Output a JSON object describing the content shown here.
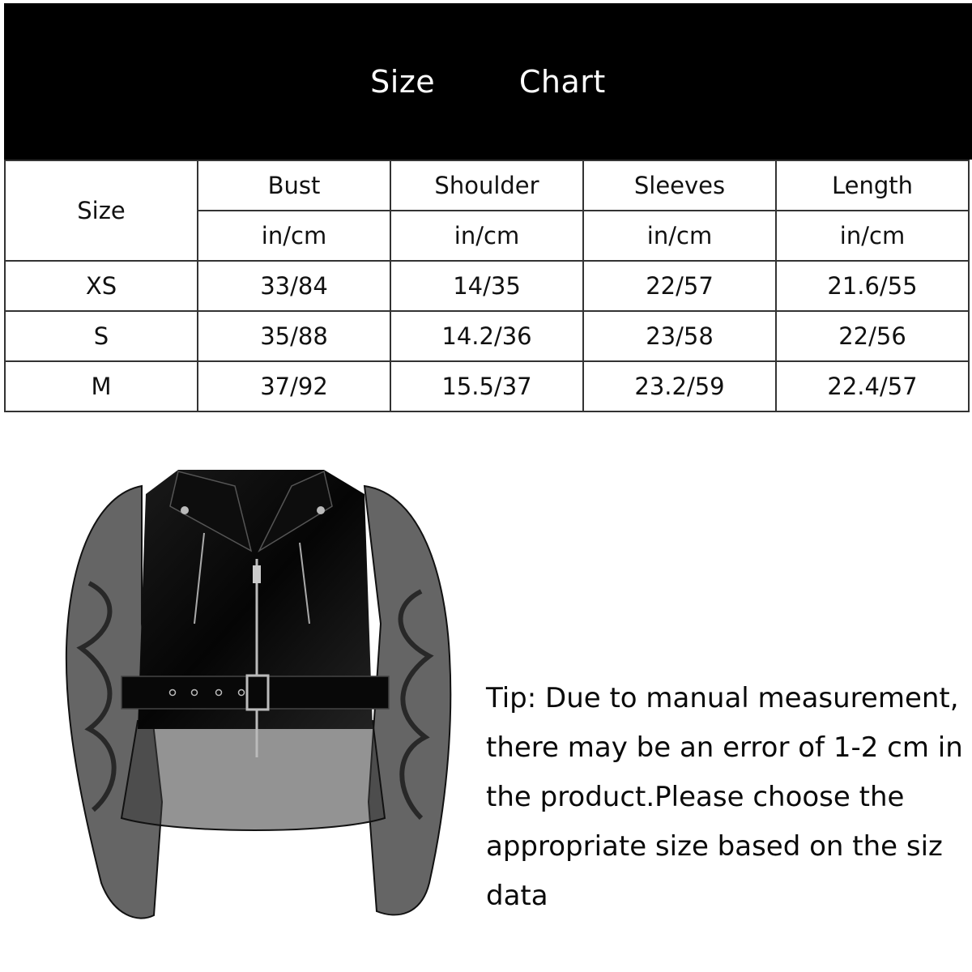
{
  "banner": {
    "title": "Size   Chart"
  },
  "size_table": {
    "size_header": "Size",
    "columns": [
      {
        "name": "Bust",
        "unit": "in/cm"
      },
      {
        "name": "Shoulder",
        "unit": "in/cm"
      },
      {
        "name": "Sleeves",
        "unit": "in/cm"
      },
      {
        "name": "Length",
        "unit": "in/cm"
      }
    ],
    "rows": [
      {
        "size": "XS",
        "values": [
          "33/84",
          "14/35",
          "22/57",
          "21.6/55"
        ]
      },
      {
        "size": "S",
        "values": [
          "35/88",
          "14.2/36",
          "23/58",
          "22/56"
        ]
      },
      {
        "size": "M",
        "values": [
          "37/92",
          "15.5/37",
          "23.2/59",
          "22.4/57"
        ]
      }
    ]
  },
  "product": {
    "image_alt": "Black leather moto jacket with sheer organza puff sleeves, belt and peplum hem"
  },
  "tip": {
    "text": "Tip: Due to manual measurement, there may be an error of 1-2 cm in the product.Please choose the appropriate size based on the siz data"
  }
}
